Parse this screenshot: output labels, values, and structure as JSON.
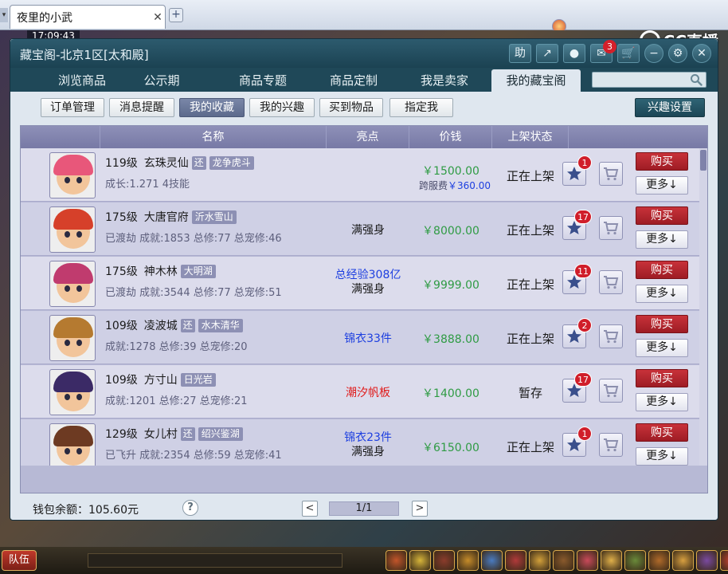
{
  "browser": {
    "tab_title": "夜里的小武",
    "close": "✕",
    "new_tab": "+"
  },
  "game": {
    "clock": "17:09:43",
    "cc_logo": "CC直播",
    "team_button": "队伍"
  },
  "window": {
    "title": "藏宝阁-北京1区[太和殿]",
    "icons": [
      {
        "name": "help",
        "glyph": "助"
      },
      {
        "name": "share",
        "glyph": "↗"
      },
      {
        "name": "record",
        "glyph": "●"
      },
      {
        "name": "message",
        "glyph": "✉",
        "badge": "3"
      },
      {
        "name": "cart",
        "glyph": "🛒"
      },
      {
        "name": "minimize",
        "glyph": "−"
      },
      {
        "name": "settings",
        "glyph": "⚙"
      },
      {
        "name": "close",
        "glyph": "✕"
      }
    ]
  },
  "nav": {
    "tabs": [
      "浏览商品",
      "公示期",
      "商品专题",
      "商品定制",
      "我是卖家",
      "我的藏宝阁"
    ],
    "active_index": 5,
    "search_placeholder": ""
  },
  "sub_nav": {
    "buttons": [
      "订单管理",
      "消息提醒",
      "我的收藏",
      "我的兴趣",
      "买到物品",
      "指定我"
    ],
    "active_index": 2,
    "interest_settings": "兴趣设置"
  },
  "table": {
    "headers": [
      "名称",
      "亮点",
      "价钱",
      "上架状态"
    ],
    "rows": [
      {
        "level": "119级",
        "name": "玄珠灵仙",
        "tag_small": "还",
        "tag": "龙争虎斗",
        "stats": "成长:1.271  4技能",
        "highlight": [],
        "highlight_color": "dark",
        "price": "￥1500.00",
        "fee_label": "跨服费",
        "fee_value": "￥360.00",
        "status": "正在上架",
        "fav_count": "1",
        "buy": "购买",
        "more": "更多↓"
      },
      {
        "level": "175级",
        "name": "大唐官府",
        "tag_small": "",
        "tag": "沂水雪山",
        "stats": "已渡劫  成就:1853  总修:77  总宠修:46",
        "highlight": [
          "满强身"
        ],
        "highlight_color": "dark",
        "price": "￥8000.00",
        "fee_label": "",
        "fee_value": "",
        "status": "正在上架",
        "fav_count": "17",
        "buy": "购买",
        "more": "更多↓"
      },
      {
        "level": "175级",
        "name": "神木林",
        "tag_small": "",
        "tag": "大明湖",
        "stats": "已渡劫  成就:3544  总修:77  总宠修:51",
        "highlight": [
          "总经验308亿",
          "满强身"
        ],
        "highlight_color": "blue-dark",
        "price": "￥9999.00",
        "fee_label": "",
        "fee_value": "",
        "status": "正在上架",
        "fav_count": "11",
        "buy": "购买",
        "more": "更多↓"
      },
      {
        "level": "109级",
        "name": "凌波城",
        "tag_small": "还",
        "tag": "水木清华",
        "stats": "成就:1278  总修:39  总宠修:20",
        "highlight": [
          "锦衣33件"
        ],
        "highlight_color": "blue",
        "price": "￥3888.00",
        "fee_label": "",
        "fee_value": "",
        "status": "正在上架",
        "fav_count": "2",
        "buy": "购买",
        "more": "更多↓"
      },
      {
        "level": "109级",
        "name": "方寸山",
        "tag_small": "",
        "tag": "日光岩",
        "stats": "成就:1201  总修:27  总宠修:21",
        "highlight": [
          "潮汐帆板"
        ],
        "highlight_color": "red",
        "price": "￥1400.00",
        "fee_label": "",
        "fee_value": "",
        "status": "暂存",
        "fav_count": "17",
        "buy": "购买",
        "more": "更多↓"
      },
      {
        "level": "129级",
        "name": "女儿村",
        "tag_small": "还",
        "tag": "绍兴鉴湖",
        "stats": "已飞升  成就:2354  总修:59  总宠修:41",
        "highlight": [
          "锦衣23件",
          "满强身"
        ],
        "highlight_color": "blue-dark",
        "price": "￥6150.00",
        "fee_label": "",
        "fee_value": "",
        "status": "正在上架",
        "fav_count": "1",
        "buy": "购买",
        "more": "更多↓"
      }
    ]
  },
  "footer": {
    "wallet": "钱包余额：105.60元",
    "help": "?",
    "prev": "<",
    "page": "1/1",
    "next": ">"
  },
  "colors": {
    "title_bar": "#1b4252",
    "buy_button": "#b2262e",
    "price": "#2f9b44",
    "highlight_blue": "#1d3fe0",
    "highlight_red": "#e01a1a"
  }
}
